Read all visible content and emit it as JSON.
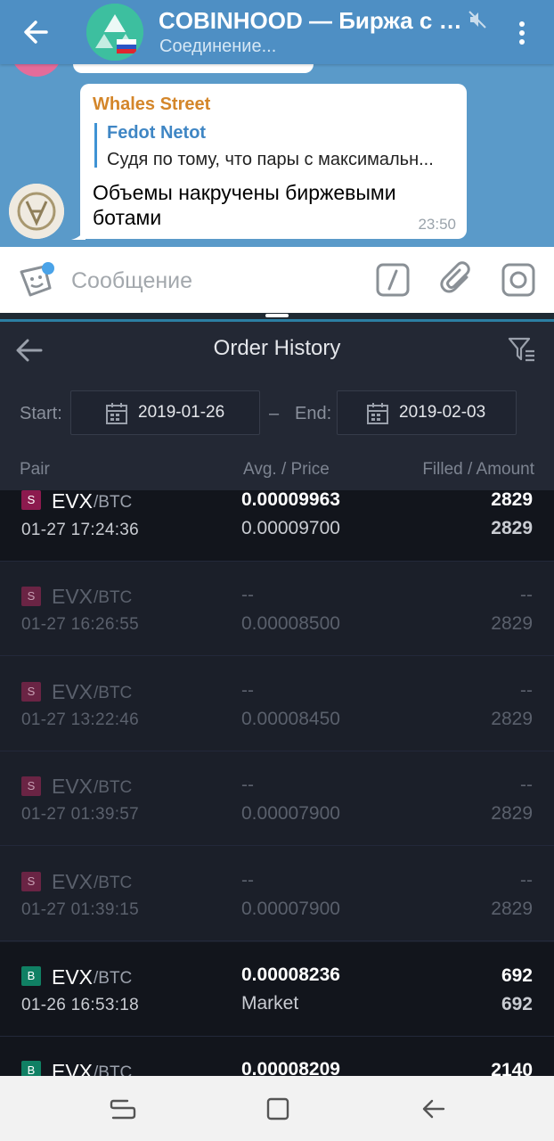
{
  "telegram": {
    "channel_title": "COBINHOOD — Биржа с н...",
    "status": "Соединение...",
    "message": {
      "sender": "Whales Street",
      "reply_to_name": "Fedot Netot",
      "reply_text": "Судя по тому, что пары с максимальн...",
      "text": "Объемы накручены биржевыми ботами",
      "time": "23:50"
    },
    "input_placeholder": "Сообщение"
  },
  "exchange": {
    "title": "Order History",
    "start_label": "Start:",
    "start_date": "2019-01-26",
    "range_separator": "–",
    "end_label": "End:",
    "end_date": "2019-02-03",
    "columns": {
      "pair": "Pair",
      "price": "Avg. / Price",
      "amount": "Filled / Amount"
    },
    "orders": [
      {
        "side": "S",
        "base": "EVX",
        "quote": "/BTC",
        "time": "01-27 17:24:36",
        "avg": "0.00009963",
        "price": "0.00009700",
        "filled": "2829",
        "amount": "2829",
        "status": "active"
      },
      {
        "side": "S",
        "base": "EVX",
        "quote": "/BTC",
        "time": "01-27 16:26:55",
        "avg": "--",
        "price": "0.00008500",
        "filled": "--",
        "amount": "2829",
        "status": "inactive"
      },
      {
        "side": "S",
        "base": "EVX",
        "quote": "/BTC",
        "time": "01-27 13:22:46",
        "avg": "--",
        "price": "0.00008450",
        "filled": "--",
        "amount": "2829",
        "status": "inactive"
      },
      {
        "side": "S",
        "base": "EVX",
        "quote": "/BTC",
        "time": "01-27 01:39:57",
        "avg": "--",
        "price": "0.00007900",
        "filled": "--",
        "amount": "2829",
        "status": "inactive"
      },
      {
        "side": "S",
        "base": "EVX",
        "quote": "/BTC",
        "time": "01-27 01:39:15",
        "avg": "--",
        "price": "0.00007900",
        "filled": "--",
        "amount": "2829",
        "status": "inactive"
      },
      {
        "side": "B",
        "base": "EVX",
        "quote": "/BTC",
        "time": "01-26 16:53:18",
        "avg": "0.00008236",
        "price": "Market",
        "filled": "692",
        "amount": "692",
        "status": "active"
      },
      {
        "side": "B",
        "base": "EVX",
        "quote": "/BTC",
        "time": "",
        "avg": "0.00008209",
        "price": "",
        "filled": "2140",
        "amount": "",
        "status": "active"
      }
    ]
  },
  "colors": {
    "telegram_header": "#4e8fc4",
    "exchange_bg": "#1b1f29",
    "sell_badge": "#8c1a4e",
    "buy_badge": "#108064"
  },
  "icons": {
    "telegram": [
      "back-arrow-icon",
      "mute-icon",
      "more-vert-icon",
      "sticker-icon",
      "bot-command-icon",
      "attach-icon",
      "camera-icon"
    ],
    "exchange": [
      "back-arrow-icon",
      "filter-icon",
      "calendar-icon"
    ],
    "nav": [
      "recents-icon",
      "home-icon",
      "back-icon"
    ]
  }
}
